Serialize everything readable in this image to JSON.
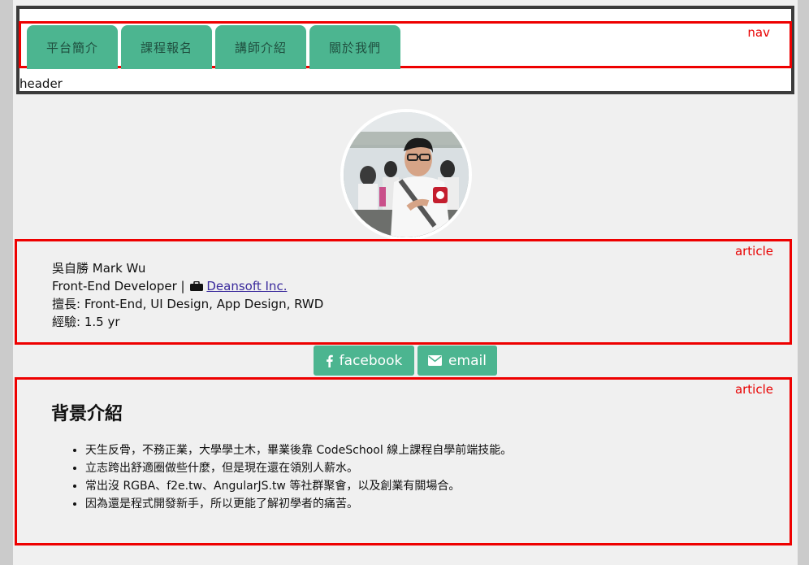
{
  "header": {
    "label": "header"
  },
  "nav": {
    "label": "nav",
    "tabs": [
      {
        "label": "平台簡介"
      },
      {
        "label": "課程報名"
      },
      {
        "label": "講師介紹"
      },
      {
        "label": "關於我們"
      }
    ]
  },
  "avatar": {
    "icon": "profile-photo"
  },
  "profile": {
    "section_label": "article",
    "name": "吳自勝 Mark Wu",
    "role": "Front-End Developer | ",
    "company_icon": "briefcase-icon",
    "company": "Deansoft Inc.",
    "skills": "擅長: Front-End, UI Design, App Design, RWD",
    "experience": "經驗: 1.5 yr"
  },
  "social": {
    "facebook_label": "facebook",
    "facebook_icon": "facebook-icon",
    "email_label": "email",
    "email_icon": "envelope-icon"
  },
  "background": {
    "section_label": "article",
    "title": "背景介紹",
    "items": [
      "天生反骨，不務正業，大學學土木，畢業後靠 CodeSchool 線上課程自學前端技能。",
      "立志跨出舒適圈做些什麼，但是現在還在領別人薪水。",
      "常出沒 RGBA、f2e.tw、AngularJS.tw 等社群聚會，以及創業有關場合。",
      "因為還是程式開發新手，所以更能了解初學者的痛苦。"
    ]
  },
  "colors": {
    "accent": "#4cb590",
    "outline_red": "#ee0000",
    "header_border": "#3b3b3b",
    "page_bg": "#f0f0f0"
  }
}
